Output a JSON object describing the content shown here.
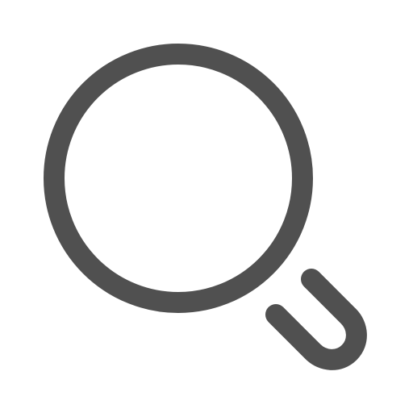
{
  "icon": {
    "name": "search-icon",
    "color": "#505050",
    "background": "#ffffff"
  }
}
